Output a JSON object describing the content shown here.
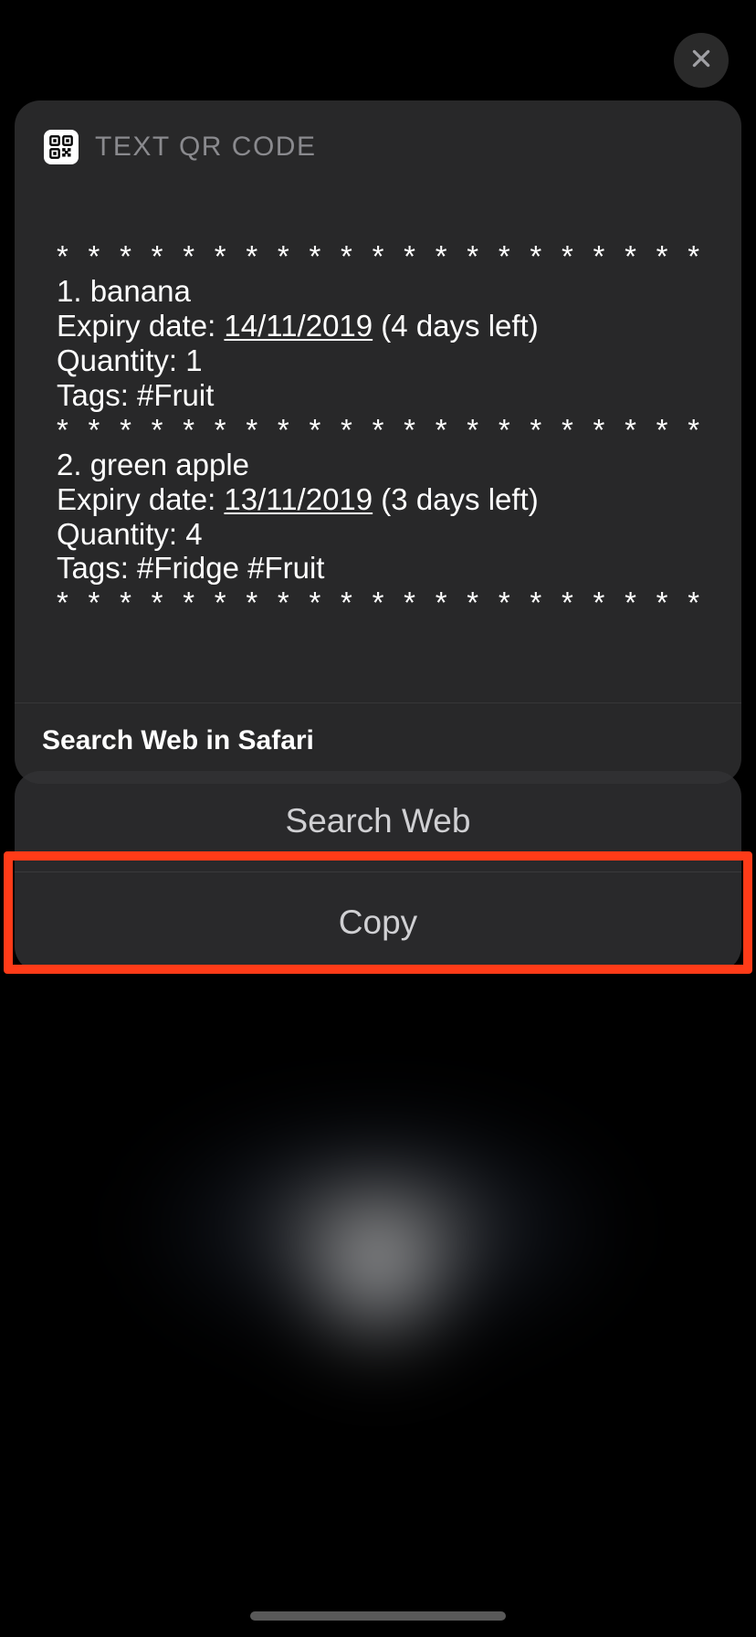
{
  "header": {
    "title": "TEXT QR CODE"
  },
  "content": {
    "separator": "* * * * * * * * * * * * * * * * * * * * * * * * * * *",
    "items": [
      {
        "index": "1",
        "name": "banana",
        "expiry_label": "Expiry date: ",
        "expiry_date": "14/11/2019",
        "expiry_remaining": " (4 days left)",
        "quantity_line": "Quantity: 1",
        "tags_line": "Tags: #Fruit"
      },
      {
        "index": "2",
        "name": "green apple",
        "expiry_label": "Expiry date: ",
        "expiry_date": "13/11/2019",
        "expiry_remaining": " (3 days left)",
        "quantity_line": "Quantity: 4",
        "tags_line": "Tags: #Fridge #Fruit"
      }
    ]
  },
  "footer": {
    "safari_search": "Search Web in Safari"
  },
  "actions": {
    "search_web": "Search Web",
    "copy": "Copy"
  }
}
